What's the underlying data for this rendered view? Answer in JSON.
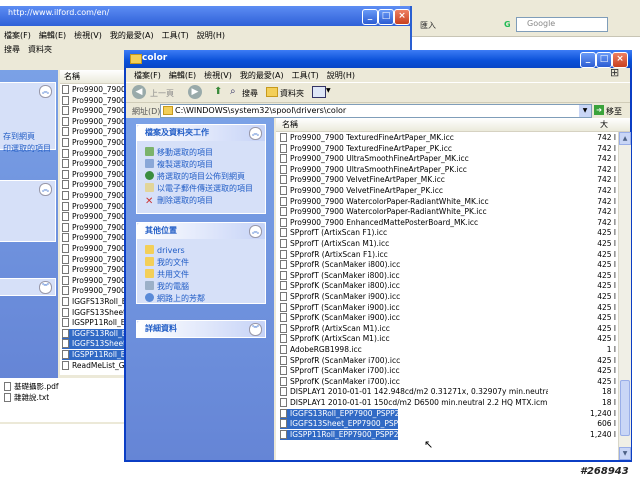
{
  "background_browser": {
    "import_label": "匯入",
    "search_placeholder": "Google"
  },
  "background_window": {
    "url": "http://www.ilford.com/en/",
    "menu": [
      "檔案(F)",
      "編輯(E)",
      "檢視(V)",
      "我的最愛(A)",
      "工具(T)",
      "說明(H)"
    ],
    "search_label": "搜尋",
    "folders_label": "資料夾",
    "list_header": "名稱",
    "files": [
      "Pro9900_7900 Pr",
      "Pro9900_7900 Pr",
      "Pro9900_7900 Pr",
      "Pro9900_7900 Pr",
      "Pro9900_7900 Pr",
      "Pro9900_7900 Pr",
      "Pro9900_7900 Pr",
      "Pro9900_7900 Pr",
      "Pro9900_7900 Pr",
      "Pro9900_7900 Pr",
      "Pro9900_7900 Sa",
      "Pro9900_7900 Sa",
      "Pro9900_7900 Sr",
      "Pro9900_7900 Te",
      "Pro9900_7900 Te",
      "Pro9900_7900 U",
      "Pro9900_7900 U",
      "Pro9900_7900 U",
      "Pro9900_7900 W",
      "Pro9900_7900 W",
      "IGGFS13Roll_EPF",
      "IGGFS13Sheet_EI",
      "IGSPP11Roll_EPF",
      "IGGFS13Roll_EP",
      "IGGFS13Sheet_E",
      "IGSPP11Roll_EP",
      "ReadMeList_Gale"
    ],
    "task_items": [
      "存到網頁",
      "印選取的項目"
    ],
    "bottom_files": [
      "基礎攝影.pdf",
      "雜雜說.txt"
    ]
  },
  "front_window": {
    "title": "color",
    "menu": [
      "檔案(F)",
      "編輯(E)",
      "檢視(V)",
      "我的最愛(A)",
      "工具(T)",
      "說明(H)"
    ],
    "toolbar": {
      "back_label": "上一頁",
      "search_label": "搜尋",
      "folders_label": "資料夾"
    },
    "address_label": "網址(D)",
    "address_value": "C:\\WINDOWS\\system32\\spool\\drivers\\color",
    "go_label": "移至",
    "tasks_panel": {
      "title": "檔案及資料夾工作",
      "items": [
        {
          "label": "移動選取的項目",
          "icon": "move-icon"
        },
        {
          "label": "複製選取的項目",
          "icon": "copy-icon"
        },
        {
          "label": "將選取的項目公佈到網頁",
          "icon": "globe-icon"
        },
        {
          "label": "以電子郵件傳送選取的項目",
          "icon": "email-icon"
        },
        {
          "label": "刪除選取的項目",
          "icon": "delete-icon"
        }
      ]
    },
    "places_panel": {
      "title": "其他位置",
      "items": [
        {
          "label": "drivers",
          "icon": "folder-icon"
        },
        {
          "label": "我的文件",
          "icon": "my-documents-icon"
        },
        {
          "label": "共用文件",
          "icon": "shared-folder-icon"
        },
        {
          "label": "我的電腦",
          "icon": "my-computer-icon"
        },
        {
          "label": "網路上的芳鄰",
          "icon": "network-icon"
        }
      ]
    },
    "details_panel": {
      "title": "詳細資料"
    },
    "columns": {
      "name": "名稱",
      "size": "大"
    },
    "files": [
      {
        "name": "Pro9900_7900 TexturedFineArtPaper_MK.icc",
        "size": "742 l",
        "selected": false
      },
      {
        "name": "Pro9900_7900 TexturedFineArtPaper_PK.icc",
        "size": "742 l",
        "selected": false
      },
      {
        "name": "Pro9900_7900 UltraSmoothFineArtPaper_MK.icc",
        "size": "742 l",
        "selected": false
      },
      {
        "name": "Pro9900_7900 UltraSmoothFineArtPaper_PK.icc",
        "size": "742 l",
        "selected": false
      },
      {
        "name": "Pro9900_7900 VelvetFineArtPaper_MK.icc",
        "size": "742 l",
        "selected": false
      },
      {
        "name": "Pro9900_7900 VelvetFineArtPaper_PK.icc",
        "size": "742 l",
        "selected": false
      },
      {
        "name": "Pro9900_7900 WatercolorPaper-RadiantWhite_MK.icc",
        "size": "742 l",
        "selected": false
      },
      {
        "name": "Pro9900_7900 WatercolorPaper-RadiantWhite_PK.icc",
        "size": "742 l",
        "selected": false
      },
      {
        "name": "Pro9900_7900 EnhancedMattePosterBoard_MK.icc",
        "size": "742 l",
        "selected": false
      },
      {
        "name": "SPprofT (ArtixScan F1).icc",
        "size": "425 l",
        "selected": false
      },
      {
        "name": "SPprofT (ArtixScan M1).icc",
        "size": "425 l",
        "selected": false
      },
      {
        "name": "SPprofR (ArtixScan F1).icc",
        "size": "425 l",
        "selected": false
      },
      {
        "name": "SPprofR (ScanMaker i800).icc",
        "size": "425 l",
        "selected": false
      },
      {
        "name": "SPprofT (ScanMaker i800).icc",
        "size": "425 l",
        "selected": false
      },
      {
        "name": "SPprofK (ScanMaker i800).icc",
        "size": "425 l",
        "selected": false
      },
      {
        "name": "SPprofR (ScanMaker i900).icc",
        "size": "425 l",
        "selected": false
      },
      {
        "name": "SPprofT (ScanMaker i900).icc",
        "size": "425 l",
        "selected": false
      },
      {
        "name": "SPprofK (ScanMaker i900).icc",
        "size": "425 l",
        "selected": false
      },
      {
        "name": "SPprofR (ArtixScan M1).icc",
        "size": "425 l",
        "selected": false
      },
      {
        "name": "SPprofK (ArtixScan M1).icc",
        "size": "425 l",
        "selected": false
      },
      {
        "name": "AdobeRGB1998.icc",
        "size": "1 l",
        "selected": false
      },
      {
        "name": "SPprofR (ScanMaker i700).icc",
        "size": "425 l",
        "selected": false
      },
      {
        "name": "SPprofT (ScanMaker i700).icc",
        "size": "425 l",
        "selected": false
      },
      {
        "name": "SPprofK (ScanMaker i700).icc",
        "size": "425 l",
        "selected": false
      },
      {
        "name": "DISPLAY1 2010-01-01 142.948cd/m2 0.31271x, 0.32907y min.neutral 2.2 HQ MTX.icm",
        "size": "18 l",
        "selected": false
      },
      {
        "name": "DISPLAY1 2010-01-01 150cd/m2 D6500 min.neutral 2.2 HQ MTX.icm",
        "size": "18 l",
        "selected": false
      },
      {
        "name": "IGGFS13Roll_EPP7900_PSPP250n.icc",
        "size": "1,240 l",
        "selected": true
      },
      {
        "name": "IGGFS13Sheet_EPP7900_PSPP250n.icc",
        "size": "606 l",
        "selected": true
      },
      {
        "name": "IGSPP11Roll_EPP7900_PSPP250n.icc",
        "size": "1,240 l",
        "selected": true
      }
    ]
  },
  "watermark": "#268943"
}
